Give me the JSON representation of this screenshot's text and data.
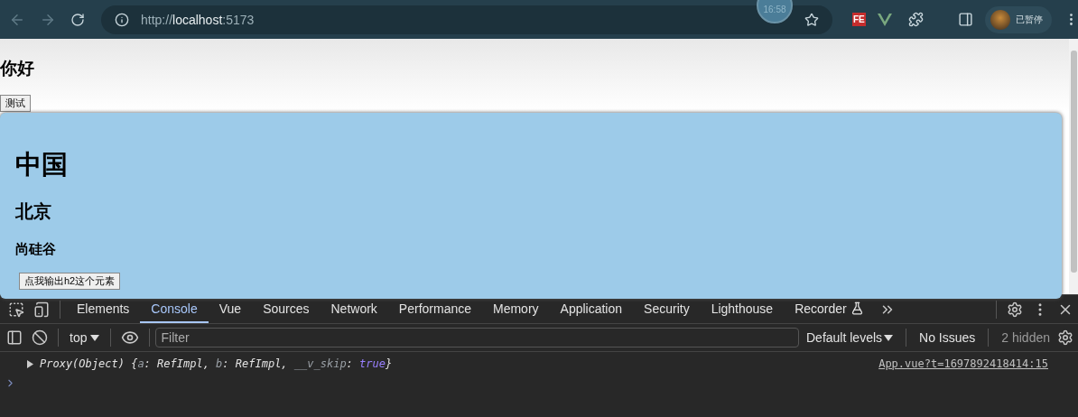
{
  "browser": {
    "url_scheme": "http://",
    "url_host": "localhost",
    "url_port": ":5173",
    "clock": "16:58",
    "profile_label": "已暂停",
    "extension_badge": "FE"
  },
  "page": {
    "heading": "你好",
    "button": "测试",
    "panel": {
      "title": "中国",
      "subtitle": "北京",
      "caption": "尚硅谷",
      "button": "点我输出h2这个元素"
    }
  },
  "devtools": {
    "tabs": [
      {
        "label": "Elements",
        "selected": false
      },
      {
        "label": "Console",
        "selected": true
      },
      {
        "label": "Vue",
        "selected": false
      },
      {
        "label": "Sources",
        "selected": false
      },
      {
        "label": "Network",
        "selected": false
      },
      {
        "label": "Performance",
        "selected": false
      },
      {
        "label": "Memory",
        "selected": false
      },
      {
        "label": "Application",
        "selected": false
      },
      {
        "label": "Security",
        "selected": false
      },
      {
        "label": "Lighthouse",
        "selected": false
      },
      {
        "label": "Recorder",
        "selected": false
      }
    ],
    "context": "top",
    "filter_placeholder": "Filter",
    "levels": "Default levels",
    "issues": "No Issues",
    "hidden": "2 hidden",
    "messages": [
      {
        "parts": [
          {
            "kind": "plain",
            "text": "Proxy(Object) {"
          },
          {
            "kind": "key",
            "text": "a"
          },
          {
            "kind": "plain",
            "text": ": RefImpl, "
          },
          {
            "kind": "key",
            "text": "b"
          },
          {
            "kind": "plain",
            "text": ": RefImpl, "
          },
          {
            "kind": "key",
            "text": "__v_skip"
          },
          {
            "kind": "plain",
            "text": ": "
          },
          {
            "kind": "bool",
            "text": "true"
          },
          {
            "kind": "plain",
            "text": "}"
          }
        ],
        "source": "App.vue?t=1697892418414:15"
      }
    ]
  }
}
